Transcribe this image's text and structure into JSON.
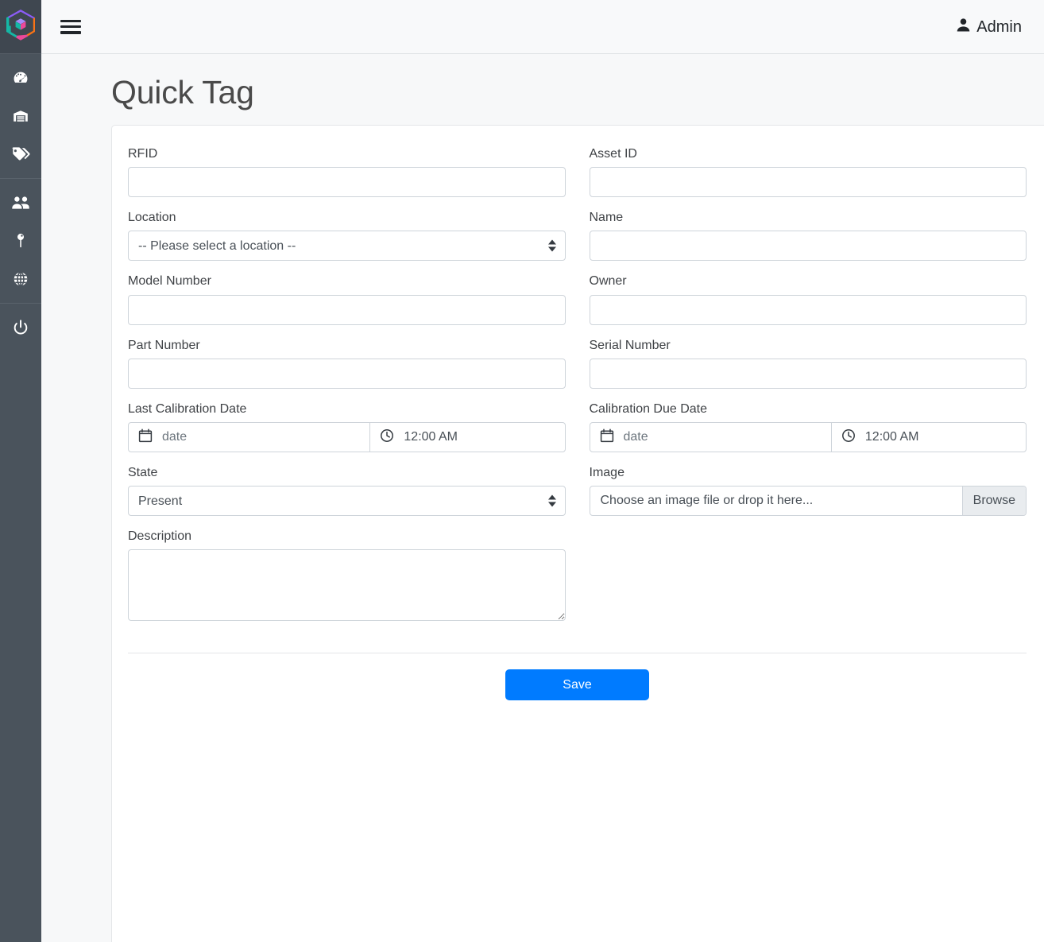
{
  "app": {
    "logo_icon": "hex-cube-logo-icon",
    "brand_colors": {
      "purple": "#8b5cf6",
      "teal": "#14b8a6",
      "orange": "#f97316",
      "pink": "#ec4899"
    },
    "sidebar_bg": "#4a535c"
  },
  "topbar": {
    "menu_icon": "hamburger-menu-icon",
    "user_icon": "user-icon",
    "user_label": "Admin"
  },
  "page": {
    "title": "Quick Tag"
  },
  "sidebar": {
    "groups": [
      {
        "items": [
          {
            "icon": "dashboard-gauge-icon",
            "name": "sidebar-item-dashboard"
          },
          {
            "icon": "warehouse-icon",
            "name": "sidebar-item-warehouse"
          },
          {
            "icon": "tags-icon",
            "name": "sidebar-item-tags"
          }
        ]
      },
      {
        "items": [
          {
            "icon": "users-icon",
            "name": "sidebar-item-users"
          },
          {
            "icon": "map-pin-icon",
            "name": "sidebar-item-locations"
          },
          {
            "icon": "globe-icon",
            "name": "sidebar-item-global"
          }
        ]
      },
      {
        "items": [
          {
            "icon": "power-icon",
            "name": "sidebar-item-logout"
          }
        ]
      }
    ]
  },
  "form": {
    "rfid": {
      "label": "RFID",
      "value": "",
      "placeholder": ""
    },
    "asset_id": {
      "label": "Asset ID",
      "value": "",
      "placeholder": ""
    },
    "location": {
      "label": "Location",
      "selected": "-- Please select a location --",
      "options": [
        "-- Please select a location --"
      ]
    },
    "name": {
      "label": "Name",
      "value": "",
      "placeholder": ""
    },
    "model_number": {
      "label": "Model Number",
      "value": "",
      "placeholder": ""
    },
    "owner": {
      "label": "Owner",
      "value": "",
      "placeholder": ""
    },
    "part_number": {
      "label": "Part Number",
      "value": "",
      "placeholder": ""
    },
    "serial_number": {
      "label": "Serial Number",
      "value": "",
      "placeholder": ""
    },
    "last_calibration_date": {
      "label": "Last Calibration Date",
      "date_icon": "calendar-icon",
      "date_placeholder": "date",
      "time_icon": "clock-icon",
      "time_value": "12:00 AM"
    },
    "calibration_due_date": {
      "label": "Calibration Due Date",
      "date_icon": "calendar-icon",
      "date_placeholder": "date",
      "time_icon": "clock-icon",
      "time_value": "12:00 AM"
    },
    "state": {
      "label": "State",
      "selected": "Present",
      "options": [
        "Present"
      ]
    },
    "image": {
      "label": "Image",
      "placeholder": "Choose an image file or drop it here...",
      "browse_label": "Browse"
    },
    "description": {
      "label": "Description",
      "value": "",
      "placeholder": ""
    },
    "save_label": "Save",
    "save_color": "#007bff"
  }
}
